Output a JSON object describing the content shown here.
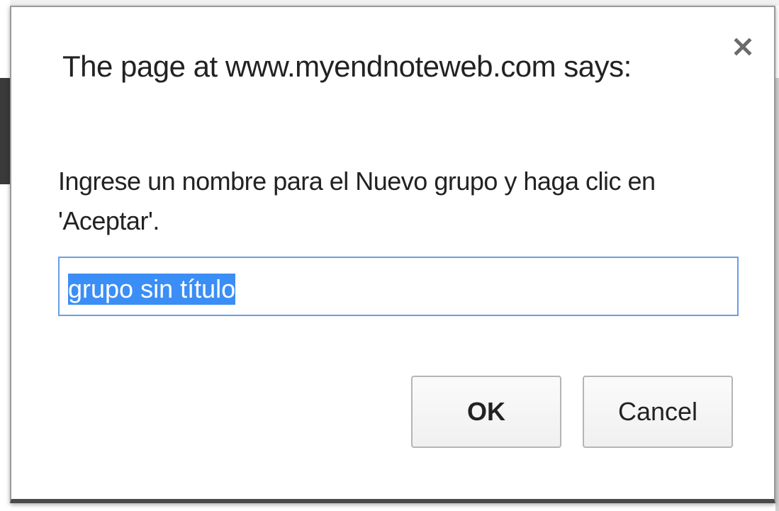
{
  "dialog": {
    "title": "The page at www.myendnoteweb.com says:",
    "message": "Ingrese un nombre para el Nuevo grupo y haga clic en 'Aceptar'.",
    "input_value": "grupo sin título",
    "ok_label": "OK",
    "cancel_label": "Cancel",
    "close_icon": "close-icon"
  },
  "colors": {
    "selection": "#3b8ef5",
    "input_border_focus": "#6a9ee8",
    "text": "#222222"
  }
}
